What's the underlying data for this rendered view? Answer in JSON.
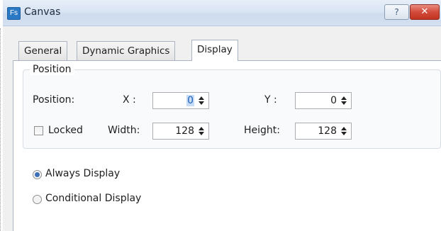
{
  "window": {
    "icon_text": "Fs",
    "title": "Canvas",
    "help_label": "?",
    "close_label": "✕"
  },
  "tabs": [
    {
      "label": "General"
    },
    {
      "label": "Dynamic Graphics"
    },
    {
      "label": "Display"
    }
  ],
  "active_tab": "Display",
  "position_group": {
    "title": "Position",
    "position_label": "Position:",
    "x_label": "X :",
    "x_value": "0",
    "y_label": "Y :",
    "y_value": "0",
    "locked_label": "Locked",
    "locked_checked": false,
    "width_label": "Width:",
    "width_value": "128",
    "height_label": "Height:",
    "height_value": "128"
  },
  "display_mode": {
    "options": [
      {
        "label": "Always Display",
        "selected": true
      },
      {
        "label": "Conditional Display",
        "selected": false
      }
    ]
  },
  "colors": {
    "title_gradient": "#d9e5f3",
    "close_red": "#c23320",
    "selection": "#c6dcf6"
  }
}
